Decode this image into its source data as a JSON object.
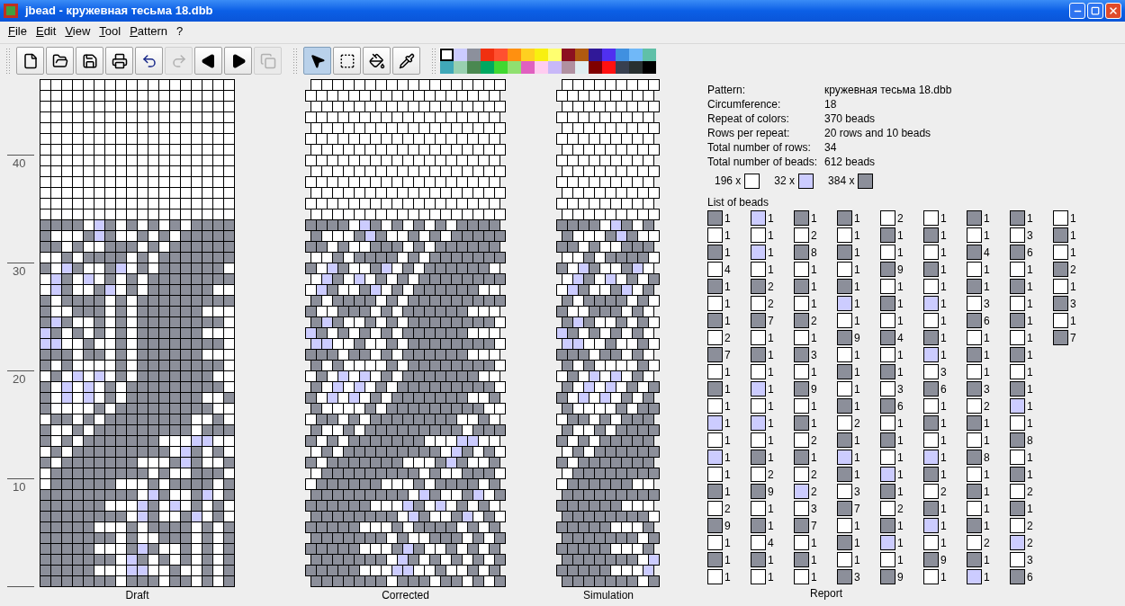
{
  "window": {
    "title": "jbead - кружевная тесьма 18.dbb"
  },
  "menu": [
    "File",
    "Edit",
    "View",
    "Tool",
    "Pattern",
    "?"
  ],
  "toolbars": [
    {
      "tools": [
        {
          "kind": "new",
          "disabled": false,
          "selected": false
        },
        {
          "kind": "open",
          "disabled": false,
          "selected": false
        },
        {
          "kind": "save",
          "disabled": false,
          "selected": false
        },
        {
          "kind": "print",
          "disabled": false,
          "selected": false
        },
        {
          "kind": "undo",
          "disabled": false,
          "selected": false
        },
        {
          "kind": "redo",
          "disabled": true,
          "selected": false
        },
        {
          "kind": "prev",
          "disabled": false,
          "selected": false
        },
        {
          "kind": "next",
          "disabled": false,
          "selected": false
        },
        {
          "kind": "copy",
          "disabled": true,
          "selected": false
        }
      ]
    },
    {
      "tools": [
        {
          "kind": "select",
          "disabled": false,
          "selected": true
        },
        {
          "kind": "rect",
          "disabled": false,
          "selected": false
        },
        {
          "kind": "fill",
          "disabled": false,
          "selected": false
        },
        {
          "kind": "pick",
          "disabled": false,
          "selected": false
        }
      ]
    }
  ],
  "palette": [
    {
      "color": "#ffffff",
      "selected": true
    },
    {
      "color": "#ccccff",
      "selected": false
    },
    {
      "color": "#8c909c",
      "selected": false
    },
    {
      "color": "#f03010",
      "selected": false
    },
    {
      "color": "#ff5030",
      "selected": false
    },
    {
      "color": "#ff9010",
      "selected": false
    },
    {
      "color": "#ffd020",
      "selected": false
    },
    {
      "color": "#f8f010",
      "selected": false
    },
    {
      "color": "#ffff70",
      "selected": false
    },
    {
      "color": "#8c1020",
      "selected": false
    },
    {
      "color": "#b05a10",
      "selected": false
    },
    {
      "color": "#301898",
      "selected": false
    },
    {
      "color": "#5030f0",
      "selected": false
    },
    {
      "color": "#4090e0",
      "selected": false
    },
    {
      "color": "#70b8f8",
      "selected": false
    },
    {
      "color": "#60c0a8",
      "selected": false
    },
    {
      "color": "#40a8b8",
      "selected": false
    },
    {
      "color": "#98d0b0",
      "selected": false
    },
    {
      "color": "#4a8850",
      "selected": false
    },
    {
      "color": "#00a860",
      "selected": false
    },
    {
      "color": "#40d830",
      "selected": false
    },
    {
      "color": "#90e070",
      "selected": false
    },
    {
      "color": "#e060c0",
      "selected": false
    },
    {
      "color": "#ffccf0",
      "selected": false
    },
    {
      "color": "#c8b8f8",
      "selected": false
    },
    {
      "color": "#b090a0",
      "selected": false
    },
    {
      "color": "#e0eef0",
      "selected": false
    },
    {
      "color": "#800000",
      "selected": false
    },
    {
      "color": "#ff1010",
      "selected": false
    },
    {
      "color": "#384050",
      "selected": false
    },
    {
      "color": "#283030",
      "selected": false
    },
    {
      "color": "#000000",
      "selected": false
    }
  ],
  "draft": {
    "label": "Draft",
    "ruler": [
      "40",
      "30",
      "20",
      "10"
    ]
  },
  "corrected": {
    "label": "Corrected"
  },
  "simulation": {
    "label": "Simulation"
  },
  "report": {
    "label": "Report",
    "info": [
      {
        "label": "Pattern:",
        "value": "кружевная тесьма 18.dbb"
      },
      {
        "label": "Circumference:",
        "value": "18"
      },
      {
        "label": "Repeat of colors:",
        "value": "370 beads"
      },
      {
        "label": "Rows per repeat:",
        "value": "20 rows and 10 beads"
      },
      {
        "label": "Total number of rows:",
        "value": "34"
      },
      {
        "label": "Total number of beads:",
        "value": "612 beads"
      }
    ],
    "summary": [
      {
        "count": "196 x",
        "color": "#ffffff"
      },
      {
        "count": "32 x",
        "color": "#ccccff"
      },
      {
        "count": "384 x",
        "color": "#8c8f9a"
      }
    ],
    "list_title": "List of beads",
    "beads": [
      {
        "color": "#8c8f9a",
        "count": "1"
      },
      {
        "color": "#ffffff",
        "count": "1"
      },
      {
        "color": "#8c8f9a",
        "count": "1"
      },
      {
        "color": "#ffffff",
        "count": "4"
      },
      {
        "color": "#8c8f9a",
        "count": "1"
      },
      {
        "color": "#ffffff",
        "count": "1"
      },
      {
        "color": "#8c8f9a",
        "count": "1"
      },
      {
        "color": "#ffffff",
        "count": "2"
      },
      {
        "color": "#8c8f9a",
        "count": "7"
      },
      {
        "color": "#ffffff",
        "count": "1"
      },
      {
        "color": "#8c8f9a",
        "count": "1"
      },
      {
        "color": "#ffffff",
        "count": "1"
      },
      {
        "color": "#ccccff",
        "count": "1"
      },
      {
        "color": "#ffffff",
        "count": "1"
      },
      {
        "color": "#ccccff",
        "count": "1"
      },
      {
        "color": "#ffffff",
        "count": "1"
      },
      {
        "color": "#8c8f9a",
        "count": "1"
      },
      {
        "color": "#ffffff",
        "count": "2"
      },
      {
        "color": "#8c8f9a",
        "count": "9"
      },
      {
        "color": "#ffffff",
        "count": "1"
      },
      {
        "color": "#8c8f9a",
        "count": "1"
      },
      {
        "color": "#ffffff",
        "count": "1"
      },
      {
        "color": "#ccccff",
        "count": "1"
      },
      {
        "color": "#ffffff",
        "count": "1"
      },
      {
        "color": "#ccccff",
        "count": "1"
      },
      {
        "color": "#ffffff",
        "count": "1"
      },
      {
        "color": "#8c8f9a",
        "count": "2"
      },
      {
        "color": "#ffffff",
        "count": "2"
      },
      {
        "color": "#8c8f9a",
        "count": "7"
      },
      {
        "color": "#ffffff",
        "count": "1"
      },
      {
        "color": "#8c8f9a",
        "count": "1"
      },
      {
        "color": "#ffffff",
        "count": "1"
      },
      {
        "color": "#ccccff",
        "count": "1"
      },
      {
        "color": "#ffffff",
        "count": "1"
      },
      {
        "color": "#ccccff",
        "count": "1"
      },
      {
        "color": "#ffffff",
        "count": "1"
      },
      {
        "color": "#8c8f9a",
        "count": "1"
      },
      {
        "color": "#ffffff",
        "count": "2"
      },
      {
        "color": "#8c8f9a",
        "count": "9"
      },
      {
        "color": "#ffffff",
        "count": "1"
      },
      {
        "color": "#8c8f9a",
        "count": "1"
      },
      {
        "color": "#ffffff",
        "count": "4"
      },
      {
        "color": "#8c8f9a",
        "count": "1"
      },
      {
        "color": "#ffffff",
        "count": "1"
      },
      {
        "color": "#8c8f9a",
        "count": "1"
      },
      {
        "color": "#ffffff",
        "count": "2"
      },
      {
        "color": "#8c8f9a",
        "count": "8"
      },
      {
        "color": "#ffffff",
        "count": "1"
      },
      {
        "color": "#8c8f9a",
        "count": "1"
      },
      {
        "color": "#ffffff",
        "count": "1"
      },
      {
        "color": "#8c8f9a",
        "count": "2"
      },
      {
        "color": "#ffffff",
        "count": "1"
      },
      {
        "color": "#8c8f9a",
        "count": "3"
      },
      {
        "color": "#ffffff",
        "count": "1"
      },
      {
        "color": "#8c8f9a",
        "count": "9"
      },
      {
        "color": "#ffffff",
        "count": "1"
      },
      {
        "color": "#8c8f9a",
        "count": "1"
      },
      {
        "color": "#ffffff",
        "count": "2"
      },
      {
        "color": "#8c8f9a",
        "count": "1"
      },
      {
        "color": "#ffffff",
        "count": "2"
      },
      {
        "color": "#ccccff",
        "count": "2"
      },
      {
        "color": "#ffffff",
        "count": "3"
      },
      {
        "color": "#8c8f9a",
        "count": "7"
      },
      {
        "color": "#ffffff",
        "count": "1"
      },
      {
        "color": "#8c8f9a",
        "count": "1"
      },
      {
        "color": "#ffffff",
        "count": "1"
      },
      {
        "color": "#8c8f9a",
        "count": "1"
      },
      {
        "color": "#ffffff",
        "count": "1"
      },
      {
        "color": "#8c8f9a",
        "count": "1"
      },
      {
        "color": "#ffffff",
        "count": "1"
      },
      {
        "color": "#8c8f9a",
        "count": "1"
      },
      {
        "color": "#ccccff",
        "count": "1"
      },
      {
        "color": "#ffffff",
        "count": "1"
      },
      {
        "color": "#8c8f9a",
        "count": "9"
      },
      {
        "color": "#ffffff",
        "count": "1"
      },
      {
        "color": "#8c8f9a",
        "count": "1"
      },
      {
        "color": "#ffffff",
        "count": "1"
      },
      {
        "color": "#8c8f9a",
        "count": "1"
      },
      {
        "color": "#ffffff",
        "count": "2"
      },
      {
        "color": "#8c8f9a",
        "count": "1"
      },
      {
        "color": "#ccccff",
        "count": "1"
      },
      {
        "color": "#8c8f9a",
        "count": "1"
      },
      {
        "color": "#ffffff",
        "count": "3"
      },
      {
        "color": "#8c8f9a",
        "count": "7"
      },
      {
        "color": "#ffffff",
        "count": "1"
      },
      {
        "color": "#8c8f9a",
        "count": "1"
      },
      {
        "color": "#ffffff",
        "count": "1"
      },
      {
        "color": "#8c8f9a",
        "count": "3"
      },
      {
        "color": "#ffffff",
        "count": "2"
      },
      {
        "color": "#8c8f9a",
        "count": "1"
      },
      {
        "color": "#ffffff",
        "count": "1"
      },
      {
        "color": "#8c8f9a",
        "count": "9"
      },
      {
        "color": "#ffffff",
        "count": "1"
      },
      {
        "color": "#8c8f9a",
        "count": "1"
      },
      {
        "color": "#ffffff",
        "count": "1"
      },
      {
        "color": "#8c8f9a",
        "count": "4"
      },
      {
        "color": "#ffffff",
        "count": "1"
      },
      {
        "color": "#8c8f9a",
        "count": "1"
      },
      {
        "color": "#ffffff",
        "count": "3"
      },
      {
        "color": "#8c8f9a",
        "count": "6"
      },
      {
        "color": "#ffffff",
        "count": "1"
      },
      {
        "color": "#8c8f9a",
        "count": "1"
      },
      {
        "color": "#ffffff",
        "count": "1"
      },
      {
        "color": "#ccccff",
        "count": "1"
      },
      {
        "color": "#8c8f9a",
        "count": "1"
      },
      {
        "color": "#ffffff",
        "count": "2"
      },
      {
        "color": "#8c8f9a",
        "count": "1"
      },
      {
        "color": "#ccccff",
        "count": "1"
      },
      {
        "color": "#ffffff",
        "count": "1"
      },
      {
        "color": "#8c8f9a",
        "count": "9"
      },
      {
        "color": "#ffffff",
        "count": "1"
      },
      {
        "color": "#8c8f9a",
        "count": "1"
      },
      {
        "color": "#ffffff",
        "count": "1"
      },
      {
        "color": "#8c8f9a",
        "count": "1"
      },
      {
        "color": "#ffffff",
        "count": "1"
      },
      {
        "color": "#ccccff",
        "count": "1"
      },
      {
        "color": "#ffffff",
        "count": "1"
      },
      {
        "color": "#8c8f9a",
        "count": "1"
      },
      {
        "color": "#ccccff",
        "count": "1"
      },
      {
        "color": "#ffffff",
        "count": "3"
      },
      {
        "color": "#8c8f9a",
        "count": "6"
      },
      {
        "color": "#ffffff",
        "count": "1"
      },
      {
        "color": "#8c8f9a",
        "count": "1"
      },
      {
        "color": "#ffffff",
        "count": "1"
      },
      {
        "color": "#ccccff",
        "count": "1"
      },
      {
        "color": "#8c8f9a",
        "count": "1"
      },
      {
        "color": "#ffffff",
        "count": "2"
      },
      {
        "color": "#8c8f9a",
        "count": "1"
      },
      {
        "color": "#ccccff",
        "count": "1"
      },
      {
        "color": "#ffffff",
        "count": "1"
      },
      {
        "color": "#8c8f9a",
        "count": "9"
      },
      {
        "color": "#ffffff",
        "count": "1"
      },
      {
        "color": "#8c8f9a",
        "count": "1"
      },
      {
        "color": "#ffffff",
        "count": "1"
      },
      {
        "color": "#8c8f9a",
        "count": "4"
      },
      {
        "color": "#ffffff",
        "count": "1"
      },
      {
        "color": "#8c8f9a",
        "count": "1"
      },
      {
        "color": "#ffffff",
        "count": "3"
      },
      {
        "color": "#8c8f9a",
        "count": "6"
      },
      {
        "color": "#ffffff",
        "count": "1"
      },
      {
        "color": "#8c8f9a",
        "count": "1"
      },
      {
        "color": "#ffffff",
        "count": "1"
      },
      {
        "color": "#8c8f9a",
        "count": "3"
      },
      {
        "color": "#ffffff",
        "count": "2"
      },
      {
        "color": "#8c8f9a",
        "count": "1"
      },
      {
        "color": "#ffffff",
        "count": "1"
      },
      {
        "color": "#8c8f9a",
        "count": "8"
      },
      {
        "color": "#ffffff",
        "count": "1"
      },
      {
        "color": "#8c8f9a",
        "count": "1"
      },
      {
        "color": "#ffffff",
        "count": "1"
      },
      {
        "color": "#8c8f9a",
        "count": "1"
      },
      {
        "color": "#ffffff",
        "count": "2"
      },
      {
        "color": "#8c8f9a",
        "count": "1"
      },
      {
        "color": "#ccccff",
        "count": "1"
      },
      {
        "color": "#8c8f9a",
        "count": "1"
      },
      {
        "color": "#ffffff",
        "count": "3"
      },
      {
        "color": "#8c8f9a",
        "count": "6"
      },
      {
        "color": "#ffffff",
        "count": "1"
      },
      {
        "color": "#8c8f9a",
        "count": "1"
      },
      {
        "color": "#ffffff",
        "count": "1"
      },
      {
        "color": "#8c8f9a",
        "count": "1"
      },
      {
        "color": "#ffffff",
        "count": "1"
      },
      {
        "color": "#8c8f9a",
        "count": "1"
      },
      {
        "color": "#ffffff",
        "count": "1"
      },
      {
        "color": "#8c8f9a",
        "count": "1"
      },
      {
        "color": "#ccccff",
        "count": "1"
      },
      {
        "color": "#ffffff",
        "count": "1"
      },
      {
        "color": "#8c8f9a",
        "count": "8"
      },
      {
        "color": "#ffffff",
        "count": "1"
      },
      {
        "color": "#8c8f9a",
        "count": "1"
      },
      {
        "color": "#ffffff",
        "count": "2"
      },
      {
        "color": "#8c8f9a",
        "count": "1"
      },
      {
        "color": "#ffffff",
        "count": "2"
      },
      {
        "color": "#ccccff",
        "count": "2"
      },
      {
        "color": "#ffffff",
        "count": "3"
      },
      {
        "color": "#8c8f9a",
        "count": "6"
      },
      {
        "color": "#ffffff",
        "count": "1"
      },
      {
        "color": "#8c8f9a",
        "count": "1"
      },
      {
        "color": "#ffffff",
        "count": "1"
      },
      {
        "color": "#8c8f9a",
        "count": "2"
      },
      {
        "color": "#ffffff",
        "count": "1"
      },
      {
        "color": "#8c8f9a",
        "count": "3"
      },
      {
        "color": "#ffffff",
        "count": "1"
      },
      {
        "color": "#8c8f9a",
        "count": "7"
      }
    ]
  }
}
